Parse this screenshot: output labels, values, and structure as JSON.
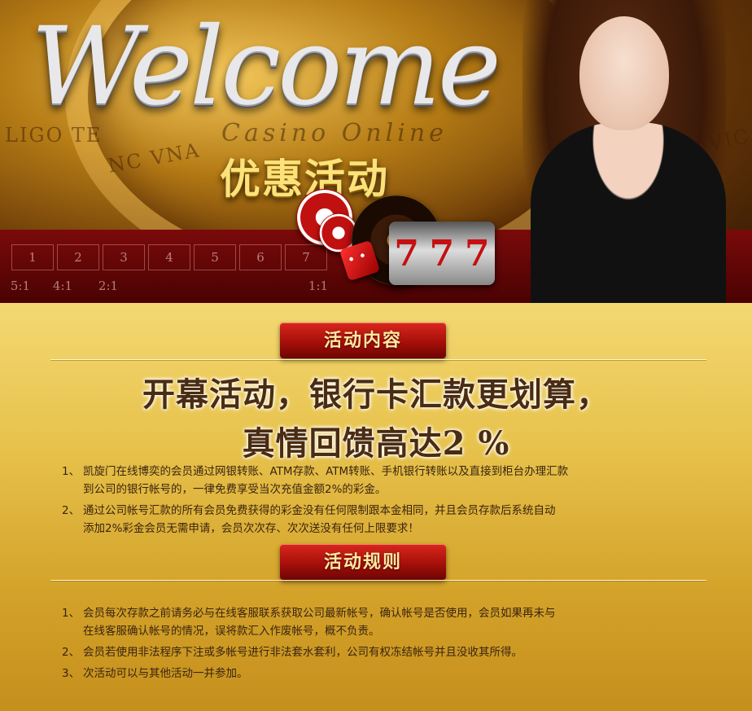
{
  "banner": {
    "welcome": "Welcome",
    "subtitle": "Casino Online",
    "promo_title": "优惠活动",
    "engravings": [
      "LIGO TE",
      "NC VNA",
      "FVIC"
    ],
    "table_numbers": [
      "1",
      "2",
      "3",
      "4",
      "5",
      "6",
      "7"
    ],
    "table_odds": [
      "5:1",
      "4:1",
      "2:1",
      "1:1"
    ],
    "slot_symbols": [
      "7",
      "7",
      "7"
    ]
  },
  "section1": {
    "heading": "活动内容",
    "headline_line1": "开幕活动，银行卡汇款更划算，",
    "headline_line2": "真情回馈高达2 %",
    "items": [
      {
        "num": "1、",
        "line1": "凯旋门在线博奕的会员通过网银转账、ATM存款、ATM转账、手机银行转账以及直接到柜台办理汇款",
        "line2": "到公司的银行帐号的，一律免费享受当次充值金额2%的彩金。"
      },
      {
        "num": "2、",
        "line1": "通过公司帐号汇款的所有会员免费获得的彩金没有任何限制跟本金相同，并且会员存款后系统自动",
        "line2": "添加2%彩金会员无需申请，会员次次存、次次送没有任何上限要求！"
      }
    ]
  },
  "section2": {
    "heading": "活动规则",
    "items": [
      {
        "num": "1、",
        "line1": "会员每次存款之前请务必与在线客服联系获取公司最新帐号，确认帐号是否使用，会员如果再未与",
        "line2": "在线客服确认帐号的情况，误将款汇入作废帐号，概不负责。"
      },
      {
        "num": "2、",
        "line1": "会员若使用非法程序下注或多帐号进行非法套水套利，公司有权冻结帐号并且没收其所得。",
        "line2": ""
      },
      {
        "num": "3、",
        "line1": "次活动可以与其他活动一并参加。",
        "line2": ""
      }
    ]
  },
  "colors": {
    "ribbon_red": "#b3140e",
    "ribbon_text": "#ffe9a0",
    "headline_text": "#4a2c12",
    "body_text": "#3a2410",
    "content_gold": "#e7c24c"
  }
}
